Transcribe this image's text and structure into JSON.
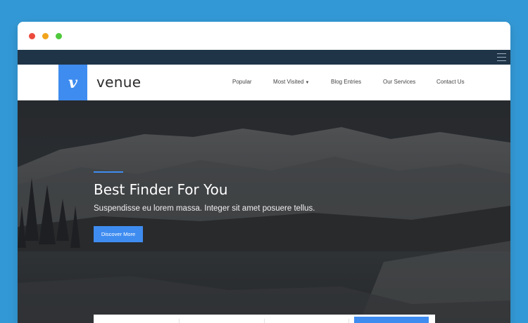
{
  "colors": {
    "page_bg": "#3399d6",
    "accent": "#3f8cf0",
    "topstrip": "#1f3447"
  },
  "window": {
    "traffic_lights": [
      "red",
      "yellow",
      "green"
    ]
  },
  "topbar": {
    "menu_icon": "hamburger-icon"
  },
  "brand": {
    "logo_letter": "v",
    "name": "venue"
  },
  "nav": {
    "items": [
      {
        "label": "Popular"
      },
      {
        "label": "Most Visited",
        "dropdown": true
      },
      {
        "label": "Blog Entries"
      },
      {
        "label": "Our Services"
      },
      {
        "label": "Contact Us"
      }
    ]
  },
  "hero": {
    "title": "Best Finder For You",
    "subtitle": "Suspendisse eu lorem massa. Integer sit amet posuere tellus.",
    "cta_label": "Discover More"
  }
}
